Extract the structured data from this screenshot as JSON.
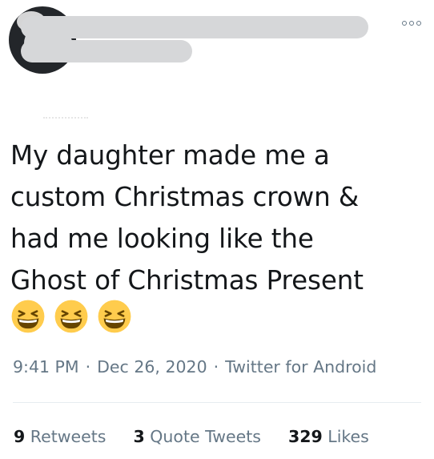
{
  "header": {
    "more_icon": "more-horizontal-icon"
  },
  "tweet": {
    "text_lines": [
      "My daughter made me a",
      "custom Christmas crown &",
      "had me looking like the",
      "Ghost of Christmas Present"
    ],
    "emojis": [
      "grinning-squinting-face",
      "grinning-squinting-face",
      "grinning-squinting-face"
    ]
  },
  "meta": {
    "time": "9:41 PM",
    "sep1": "·",
    "date": "Dec 26, 2020",
    "sep2": "·",
    "source": "Twitter for Android"
  },
  "stats": {
    "retweets_count": "9",
    "retweets_label": "Retweets",
    "quotes_count": "3",
    "quotes_label": "Quote Tweets",
    "likes_count": "329",
    "likes_label": "Likes"
  },
  "colors": {
    "text": "#14171a",
    "secondary": "#657786",
    "redaction": "#d6d7d9",
    "emoji_face": "#ffcc4d"
  }
}
